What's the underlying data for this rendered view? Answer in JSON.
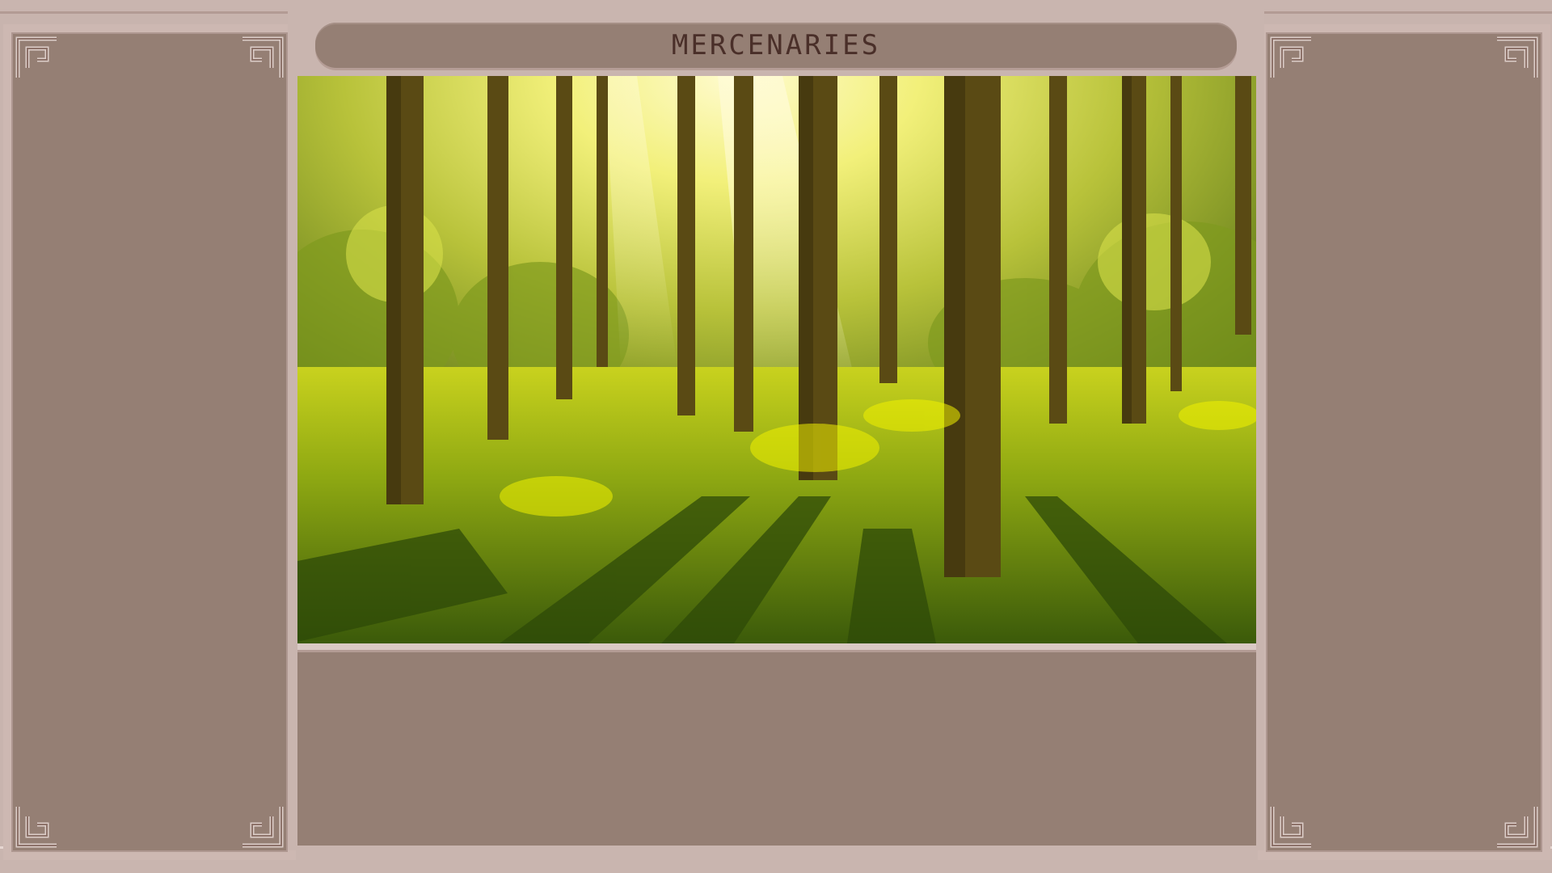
{
  "title": "MERCENARIES",
  "colors": {
    "panel": "#957f74",
    "frame": "#c9b5af",
    "title_text": "#4a2f29"
  },
  "scene": {
    "description_icon": "forest-scene"
  },
  "corner_icon": "ornament-corner-icon"
}
